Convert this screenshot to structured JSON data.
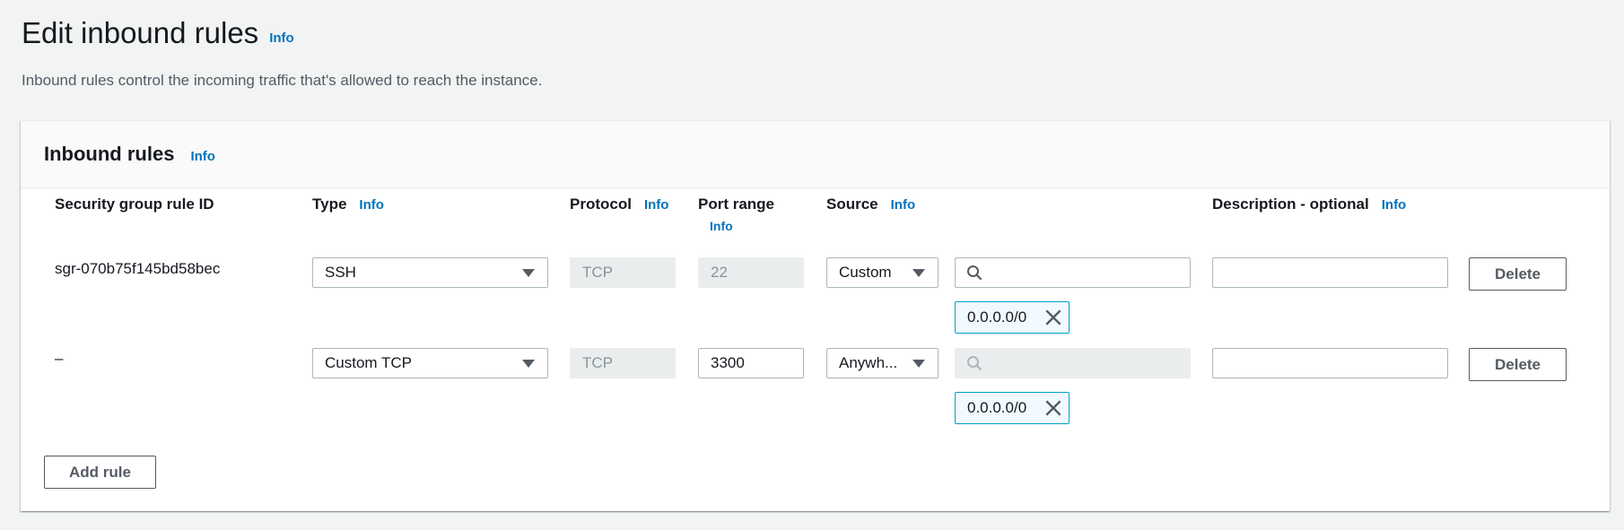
{
  "page": {
    "title": "Edit inbound rules",
    "title_info": "Info",
    "description": "Inbound rules control the incoming traffic that's allowed to reach the instance."
  },
  "panel": {
    "title": "Inbound rules",
    "title_info": "Info",
    "columns": {
      "rule_id": "Security group rule ID",
      "type": "Type",
      "type_info": "Info",
      "protocol": "Protocol",
      "protocol_info": "Info",
      "port_range": "Port range",
      "port_range_info": "Info",
      "source": "Source",
      "source_info": "Info",
      "description": "Description - optional",
      "description_info": "Info"
    },
    "rules": [
      {
        "rule_id": "sgr-070b75f145bd58bec",
        "type": "SSH",
        "protocol": "TCP",
        "port_range": "22",
        "source_type": "Custom",
        "source_search": "",
        "source_token": "0.0.0.0/0",
        "description": "",
        "delete_label": "Delete"
      },
      {
        "rule_id": "–",
        "type": "Custom TCP",
        "protocol": "TCP",
        "port_range": "3300",
        "source_type": "Anywh...",
        "source_search": "",
        "source_token": "0.0.0.0/0",
        "description": "",
        "delete_label": "Delete"
      }
    ],
    "add_rule_label": "Add rule"
  },
  "colors": {
    "info_link": "#0073bb",
    "token_border": "#00a1c9",
    "background": "#f2f3f3"
  }
}
